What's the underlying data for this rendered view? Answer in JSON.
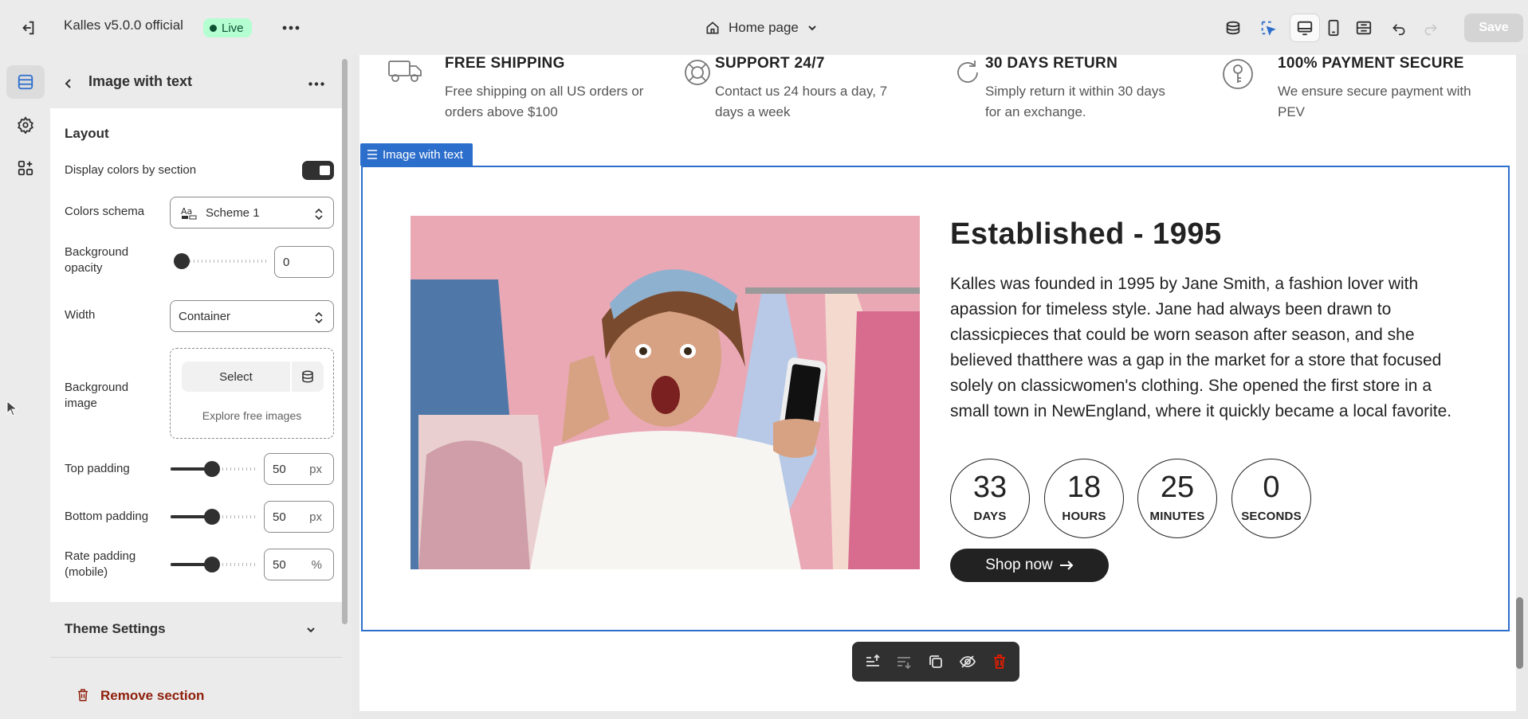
{
  "topbar": {
    "store_name": "Kalles v5.0.0 official",
    "status_badge": "Live",
    "page_selector": "Home page",
    "save_label": "Save",
    "icons": [
      "exit-icon",
      "more-icon",
      "home-icon",
      "chevron-down-icon",
      "apps-icon",
      "inspector-icon",
      "desktop-icon",
      "mobile-icon",
      "fullwidth-icon",
      "undo-icon",
      "redo-icon"
    ]
  },
  "rail": {
    "items": [
      "sections-icon",
      "settings-icon",
      "apps-icon"
    ]
  },
  "panel": {
    "title": "Image with text",
    "layout_heading": "Layout",
    "display_colors_label": "Display colors by section",
    "display_colors_on": true,
    "colors_schema_label": "Colors schema",
    "colors_schema_value": "Scheme 1",
    "bg_opacity_label": "Background opacity",
    "bg_opacity_value": "0",
    "width_label": "Width",
    "width_value": "Container",
    "bg_image_label": "Background image",
    "bg_image_select": "Select",
    "bg_image_explore": "Explore free images",
    "top_padding_label": "Top padding",
    "top_padding_value": "50",
    "bottom_padding_label": "Bottom padding",
    "bottom_padding_value": "50",
    "rate_padding_label": "Rate padding (mobile)",
    "rate_padding_value": "50",
    "unit_px": "px",
    "unit_pct": "%",
    "theme_settings_label": "Theme Settings",
    "remove_section_label": "Remove section"
  },
  "preview": {
    "features": [
      {
        "title": "FREE SHIPPING",
        "desc": "Free shipping on all US orders or orders above $100",
        "icon": "truck-icon"
      },
      {
        "title": "SUPPORT 24/7",
        "desc": "Contact us 24 hours a day, 7 days a week",
        "icon": "lifebuoy-icon"
      },
      {
        "title": "30 DAYS RETURN",
        "desc": "Simply return it within 30 days for an exchange.",
        "icon": "refresh-icon"
      },
      {
        "title": "100% PAYMENT SECURE",
        "desc": "We ensure secure payment with PEV",
        "icon": "key-icon"
      }
    ],
    "section_tag": "Image with text",
    "heading": "Established - 1995",
    "body": "Kalles was founded in 1995 by Jane Smith, a fashion lover with apassion for timeless style. Jane had always been drawn to classicpieces that could be worn season after season, and she believed thatthere was a gap in the market for a store that focused solely on classicwomen's clothing. She opened the first store in a small town in NewEngland, where it quickly became a local favorite.",
    "countdown": [
      {
        "value": "33",
        "unit": "DAYS"
      },
      {
        "value": "18",
        "unit": "HOURS"
      },
      {
        "value": "25",
        "unit": "MINUTES"
      },
      {
        "value": "0",
        "unit": "SECONDS"
      }
    ],
    "cta_label": "Shop now",
    "accent_color": "#2c6ecb"
  }
}
